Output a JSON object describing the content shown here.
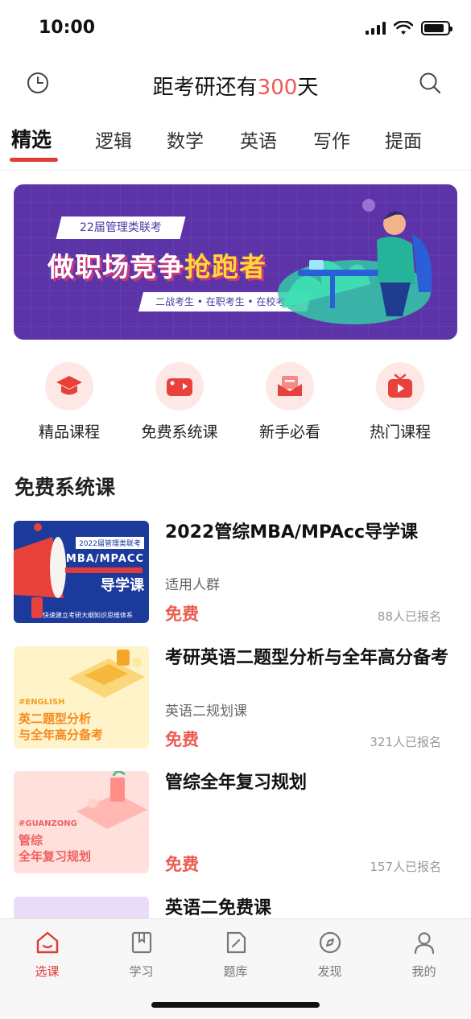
{
  "status_bar": {
    "time": "10:00",
    "battery_level": 0.85
  },
  "header": {
    "title_prefix": "距考研还有",
    "days": "300",
    "title_suffix": "天",
    "left_icon": "history-clock-icon",
    "right_icon": "search-icon"
  },
  "tabs": [
    {
      "label": "精选",
      "active": true
    },
    {
      "label": "逻辑",
      "active": false
    },
    {
      "label": "数学",
      "active": false
    },
    {
      "label": "英语",
      "active": false
    },
    {
      "label": "写作",
      "active": false
    },
    {
      "label": "提面",
      "active": false
    }
  ],
  "banner": {
    "tag": "22届管理类联考",
    "headline_main": "做职场竞争",
    "headline_highlight": "抢跑者",
    "subline": "二战考生 • 在职考生 • 在校考生"
  },
  "quick_menu": [
    {
      "label": "精品课程",
      "icon": "graduation-cap-icon"
    },
    {
      "label": "免费系统课",
      "icon": "video-camera-icon"
    },
    {
      "label": "新手必看",
      "icon": "mail-envelope-icon"
    },
    {
      "label": "热门课程",
      "icon": "tv-play-icon"
    }
  ],
  "section": {
    "title": "免费系统课"
  },
  "courses": [
    {
      "title": "2022管综MBA/MPAcc导学课",
      "subtitle": "适用人群",
      "price": "免费",
      "count": "88人已报名",
      "thumb": {
        "tag": "2022届管理类联考",
        "big": "MBA/MPACC",
        "main": "导学课",
        "foot": "快速建立考研大纲知识思维体系"
      }
    },
    {
      "title": "考研英语二题型分析与全年高分备考",
      "subtitle": "英语二规划课",
      "price": "免费",
      "count": "321人已报名",
      "thumb": {
        "tag": "#ENGLISH",
        "main": "英二题型分析\n与全年高分备考"
      }
    },
    {
      "title": "管综全年复习规划",
      "subtitle": "",
      "price": "免费",
      "count": "157人已报名",
      "thumb": {
        "tag": "#GUANZONG",
        "main": "管综\n全年复习规划"
      }
    },
    {
      "title": "英语二免费课"
    }
  ],
  "bottom_nav": [
    {
      "label": "选课",
      "icon": "home-icon",
      "active": true
    },
    {
      "label": "学习",
      "icon": "book-icon",
      "active": false
    },
    {
      "label": "题库",
      "icon": "document-edit-icon",
      "active": false
    },
    {
      "label": "发现",
      "icon": "compass-icon",
      "active": false
    },
    {
      "label": "我的",
      "icon": "user-icon",
      "active": false
    }
  ],
  "colors": {
    "accent": "#e23b36",
    "price": "#ee5a4f",
    "banner": "#5c34a8",
    "icon_bg": "#fde8e6"
  }
}
